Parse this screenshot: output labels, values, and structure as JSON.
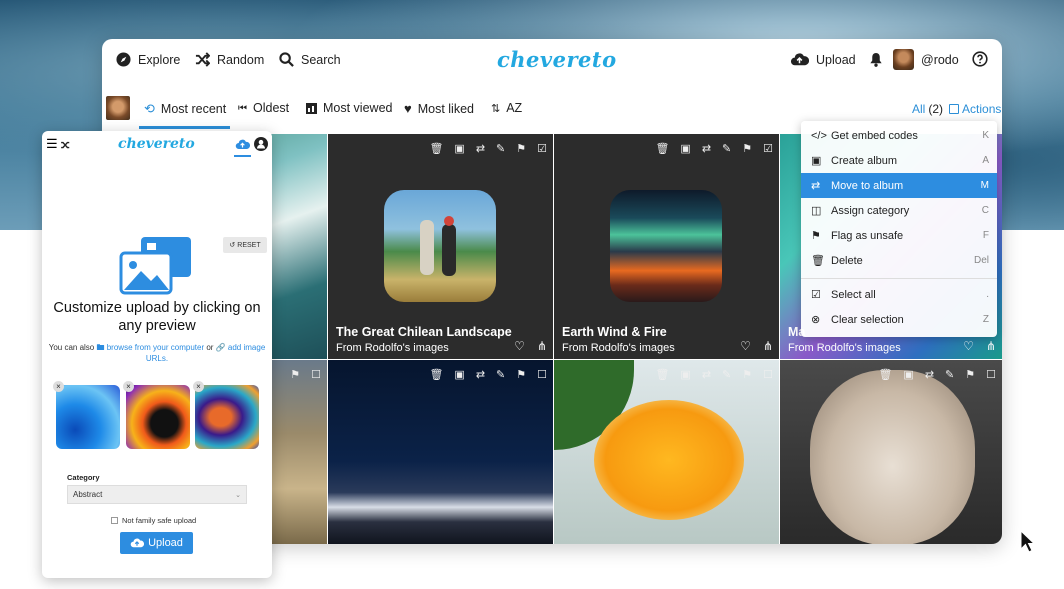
{
  "app": {
    "brand": "chevereto"
  },
  "nav": {
    "explore": "Explore",
    "random": "Random",
    "search": "Search",
    "upload": "Upload",
    "username": "@rodo"
  },
  "tabs": [
    "Most recent",
    "Oldest",
    "Most viewed",
    "Most liked",
    "AZ"
  ],
  "selection": {
    "all_label": "All",
    "count": "(2)",
    "actions_label": "Actions"
  },
  "tiles": [
    {
      "title": "The Great Chilean Landscape",
      "subtitle": "From Rodolfo's images"
    },
    {
      "title": "Earth Wind & Fire",
      "subtitle": "From Rodolfo's images"
    },
    {
      "title": "Ma",
      "subtitle": "From Rodolfo's images"
    }
  ],
  "menu": {
    "items": [
      {
        "label": "Get embed codes",
        "key": "K"
      },
      {
        "label": "Create album",
        "key": "A"
      },
      {
        "label": "Move to album",
        "key": "M"
      },
      {
        "label": "Assign category",
        "key": "C"
      },
      {
        "label": "Flag as unsafe",
        "key": "F"
      },
      {
        "label": "Delete",
        "key": "Del"
      },
      {
        "label": "Select all",
        "key": "."
      },
      {
        "label": "Clear selection",
        "key": "Z"
      }
    ],
    "selected_index": 2
  },
  "mobile": {
    "brand": "chevereto",
    "reset_label": "RESET",
    "title": "Customize upload by clicking on any preview",
    "desc_prefix": "You can also",
    "browse_link": "browse from your computer",
    "or": "or",
    "add_link": "add image URLs.",
    "category_label": "Category",
    "category_value": "Abstract",
    "family_safe_label": "Not family safe upload",
    "upload_button": "Upload"
  },
  "colors": {
    "accent": "#2d8de0",
    "brand": "#23a8e0",
    "tile_dark": "#2c2c2c"
  }
}
